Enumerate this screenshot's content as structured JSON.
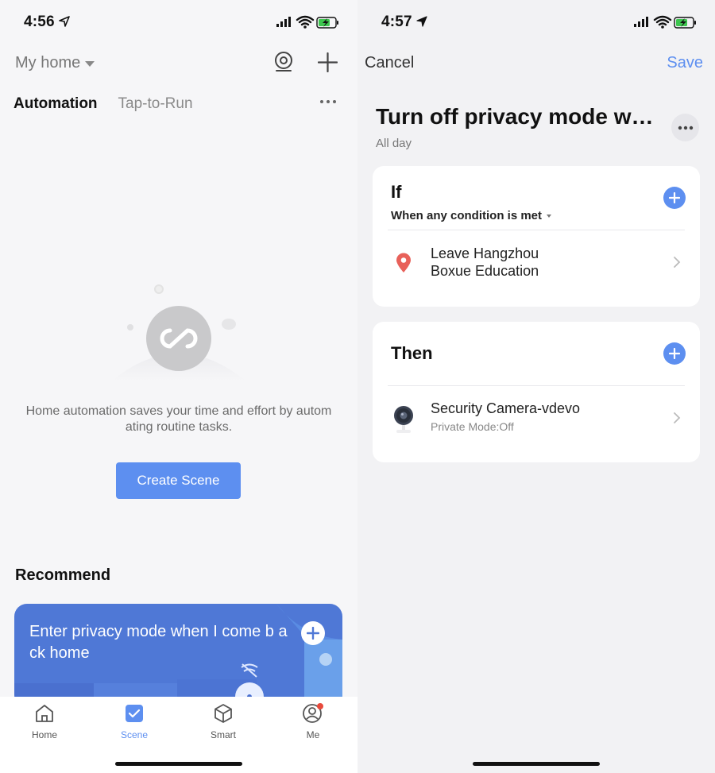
{
  "left": {
    "status": {
      "time": "4:56"
    },
    "home_selector": "My home",
    "tabs": [
      "Automation",
      "Tap-to-Run"
    ],
    "empty_message": "Home automation saves your time and effort by autom ating routine tasks.",
    "create_button": "Create Scene",
    "recommend_title": "Recommend",
    "recommend_card_text": "Enter privacy mode when I come b ack home",
    "tabbar": [
      {
        "label": "Home",
        "icon": "home-icon"
      },
      {
        "label": "Scene",
        "icon": "scene-check-icon"
      },
      {
        "label": "Smart",
        "icon": "smart-cube-icon"
      },
      {
        "label": "Me",
        "icon": "profile-icon"
      }
    ],
    "active_tab": "Scene"
  },
  "right": {
    "status": {
      "time": "4:57"
    },
    "cancel": "Cancel",
    "save": "Save",
    "scene_title": "Turn off privacy mode when I leave Hangzhou Boxue Education",
    "scene_subtitle": "All day",
    "if_card": {
      "title": "If",
      "condition_mode": "When any condition is met",
      "item": {
        "line1": "Leave Hangzhou",
        "line2": "Boxue Education",
        "icon": "location-pin-icon"
      }
    },
    "then_card": {
      "title": "Then",
      "item": {
        "line1": "Security Camera-vdevo",
        "line2": "Private Mode:Off",
        "icon": "camera-icon"
      }
    }
  },
  "colors": {
    "accent": "#5d8ff0",
    "pin": "#e8615a",
    "badge": "#e84a3c"
  }
}
